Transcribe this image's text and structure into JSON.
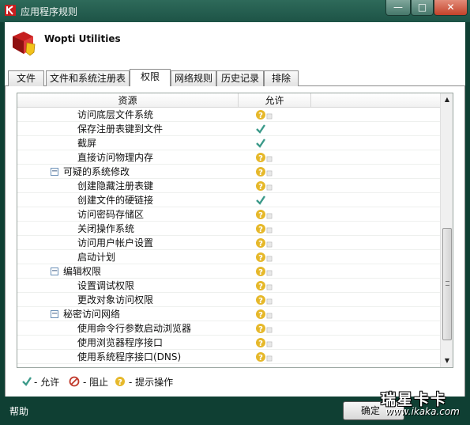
{
  "window": {
    "title": "应用程序规则",
    "min_glyph": "—",
    "max_glyph": "□",
    "close_glyph": "✕"
  },
  "app": {
    "name": "Wopti Utilities"
  },
  "tabs": [
    {
      "label": "文件",
      "active": false
    },
    {
      "label": "文件和系统注册表",
      "active": false
    },
    {
      "label": "权限",
      "active": true
    },
    {
      "label": "网络规则",
      "active": false
    },
    {
      "label": "历史记录",
      "active": false
    },
    {
      "label": "排除",
      "active": false
    }
  ],
  "grid": {
    "headers": {
      "resource": "资源",
      "allow": "允许"
    },
    "rows": [
      {
        "label": "访问底层文件系统",
        "level": 2,
        "status": "prompt"
      },
      {
        "label": "保存注册表键到文件",
        "level": 2,
        "status": "allow"
      },
      {
        "label": "截屏",
        "level": 2,
        "status": "allow"
      },
      {
        "label": "直接访问物理内存",
        "level": 2,
        "status": "prompt"
      },
      {
        "label": "可疑的系统修改",
        "level": 1,
        "status": "prompt",
        "expanded": true
      },
      {
        "label": "创建隐藏注册表键",
        "level": 2,
        "status": "prompt"
      },
      {
        "label": "创建文件的硬链接",
        "level": 2,
        "status": "allow"
      },
      {
        "label": "访问密码存储区",
        "level": 2,
        "status": "prompt"
      },
      {
        "label": "关闭操作系统",
        "level": 2,
        "status": "prompt"
      },
      {
        "label": "访问用户帐户设置",
        "level": 2,
        "status": "prompt"
      },
      {
        "label": "启动计划",
        "level": 2,
        "status": "prompt"
      },
      {
        "label": "编辑权限",
        "level": 1,
        "status": "prompt",
        "expanded": true
      },
      {
        "label": "设置调试权限",
        "level": 2,
        "status": "prompt"
      },
      {
        "label": "更改对象访问权限",
        "level": 2,
        "status": "prompt"
      },
      {
        "label": "秘密访问网络",
        "level": 1,
        "status": "prompt",
        "expanded": true
      },
      {
        "label": "使用命令行参数启动浏览器",
        "level": 2,
        "status": "prompt"
      },
      {
        "label": "使用浏览器程序接口",
        "level": 2,
        "status": "prompt"
      },
      {
        "label": "使用系统程序接口(DNS)",
        "level": 2,
        "status": "prompt"
      }
    ]
  },
  "legend": {
    "allow": "- 允许",
    "block": "- 阻止",
    "prompt": "- 提示操作"
  },
  "footer": {
    "help": "帮助",
    "ok": "确定"
  },
  "watermark": {
    "main": "瑞星卡卡",
    "sub": "www.ikaka.com"
  },
  "colors": {
    "accent": "#1d5346",
    "allow": "#3c9a8a",
    "block": "#c0392b",
    "prompt": "#e6b82a"
  }
}
